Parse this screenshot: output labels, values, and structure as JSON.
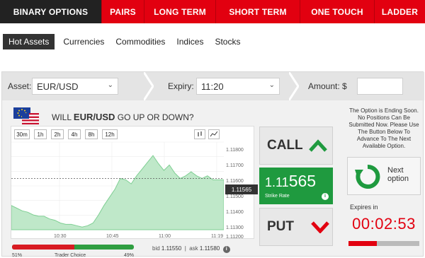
{
  "nav": {
    "tabs": [
      {
        "label": "BINARY OPTIONS",
        "active": true
      },
      {
        "label": "PAIRS"
      },
      {
        "label": "LONG TERM"
      },
      {
        "label": "SHORT TERM"
      },
      {
        "label": "ONE TOUCH"
      },
      {
        "label": "LADDER"
      }
    ]
  },
  "subnav": {
    "items": [
      {
        "label": "Hot Assets",
        "active": true
      },
      {
        "label": "Currencies"
      },
      {
        "label": "Commodities"
      },
      {
        "label": "Indices"
      },
      {
        "label": "Stocks"
      }
    ]
  },
  "trade_bar": {
    "asset_label": "Asset:",
    "asset_value": "EUR/USD",
    "expiry_label": "Expiry:",
    "expiry_value": "11:20",
    "amount_label": "Amount: $",
    "amount_value": ""
  },
  "question": {
    "prefix": "WILL ",
    "asset": "EUR/USD",
    "suffix": " GO UP OR DOWN?"
  },
  "timeframes": [
    "30m",
    "1h",
    "2h",
    "4h",
    "8h",
    "12h"
  ],
  "chart_data": {
    "type": "area",
    "x_ticks": [
      "10:30",
      "10:45",
      "11:00",
      "11:19"
    ],
    "y_ticks": [
      "1.11800",
      "1.11700",
      "1.11600",
      "1.11500",
      "1.11400",
      "1.11300",
      "1.11200"
    ],
    "ylim": [
      1.112,
      1.1185
    ],
    "current_price": "1.11565",
    "strike_line": 1.1158,
    "series": [
      {
        "values": [
          1.1138,
          1.1136,
          1.1134,
          1.1133,
          1.1131,
          1.113,
          1.113,
          1.1128,
          1.1127,
          1.1125,
          1.1124,
          1.1124,
          1.1123,
          1.1122,
          1.1123,
          1.1125,
          1.1131,
          1.1138,
          1.1144,
          1.115,
          1.1158,
          1.1157,
          1.1154,
          1.116,
          1.1165,
          1.117,
          1.1175,
          1.1169,
          1.1164,
          1.1168,
          1.1162,
          1.1158,
          1.116,
          1.1163,
          1.116,
          1.1158,
          1.116,
          1.1157,
          1.1157,
          1.1157
        ]
      }
    ],
    "grid": true
  },
  "actions": {
    "call_label": "CALL",
    "put_label": "PUT",
    "strike_value_prefix": "1.11",
    "strike_value_suffix": "565",
    "strike_label": "Strike Rate"
  },
  "trader_choice": {
    "left_pct": "51%",
    "label": "Trader Choice",
    "right_pct": "49%",
    "call_fraction": 0.51
  },
  "bid_ask": {
    "bid_label": "bid",
    "bid": "1.11550",
    "ask_label": "ask",
    "ask": "1.11580"
  },
  "side": {
    "notice": "The Option is Ending Soon. No Positions Can Be Submitted Now. Please Use The Button Below To Advance To The Next Available Option.",
    "next_label": "Next option",
    "expires_label": "Expires in",
    "timer": "00:02:53",
    "timer_fraction": 0.4
  },
  "colors": {
    "brand_red": "#e20010",
    "green": "#1f9a3f",
    "area_fill": "#bfe8c9"
  }
}
